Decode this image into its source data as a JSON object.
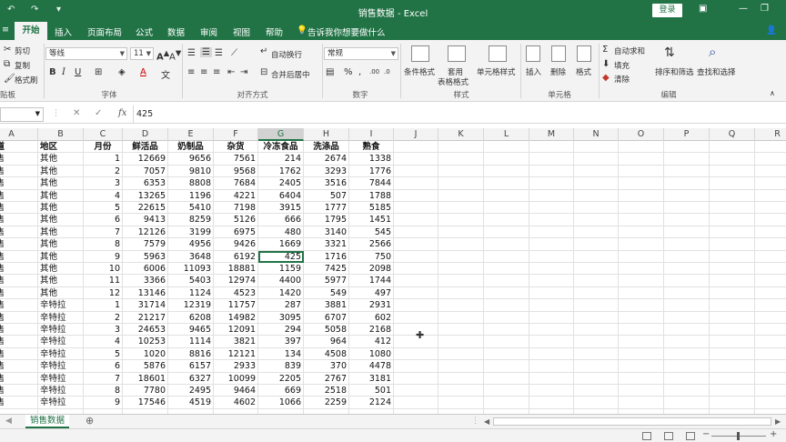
{
  "titlebar": {
    "title": "销售数据 - Excel",
    "login_label": "登录",
    "quick_access": [
      "↶",
      "↷",
      "▾"
    ]
  },
  "tabs": [
    "开始",
    "插入",
    "页面布局",
    "公式",
    "数据",
    "审阅",
    "视图",
    "帮助",
    "告诉我你想要做什么"
  ],
  "ribbon": {
    "clipboard": {
      "cut": "剪切",
      "copy": "复制",
      "format_painter": "格式刷",
      "label": "贴板"
    },
    "font": {
      "name": "等线",
      "size": "11",
      "label": "字体"
    },
    "alignment": {
      "wrap": "自动换行",
      "merge": "合并后居中",
      "label": "对齐方式"
    },
    "number": {
      "format": "常规",
      "label": "数字"
    },
    "styles": {
      "conditional": "条件格式",
      "table_format_1": "套用",
      "table_format_2": "表格格式",
      "cell_styles": "单元格样式",
      "label": "样式"
    },
    "cells": {
      "insert": "插入",
      "delete": "删除",
      "format": "格式",
      "label": "单元格"
    },
    "editing": {
      "autosum": "自动求和",
      "fill": "填充",
      "clear": "清除",
      "sort": "排序和筛选",
      "find": "查找和选择",
      "label": "编辑"
    }
  },
  "formula_bar": {
    "fx": "fx",
    "value": "425"
  },
  "columns": [
    "A",
    "B",
    "C",
    "D",
    "E",
    "F",
    "G",
    "H",
    "I",
    "J",
    "K",
    "L",
    "M",
    "N",
    "O",
    "P",
    "Q",
    "R"
  ],
  "selected_column": "G",
  "table_headers": [
    "渠道",
    "地区",
    "月份",
    "鲜活品",
    "奶制品",
    "杂货",
    "冷冻食品",
    "洗涤品",
    "熟食"
  ],
  "rows": [
    [
      "零售",
      "其他",
      "1",
      "12669",
      "9656",
      "7561",
      "214",
      "2674",
      "1338"
    ],
    [
      "零售",
      "其他",
      "2",
      "7057",
      "9810",
      "9568",
      "1762",
      "3293",
      "1776"
    ],
    [
      "零售",
      "其他",
      "3",
      "6353",
      "8808",
      "7684",
      "2405",
      "3516",
      "7844"
    ],
    [
      "零售",
      "其他",
      "4",
      "13265",
      "1196",
      "4221",
      "6404",
      "507",
      "1788"
    ],
    [
      "零售",
      "其他",
      "5",
      "22615",
      "5410",
      "7198",
      "3915",
      "1777",
      "5185"
    ],
    [
      "零售",
      "其他",
      "6",
      "9413",
      "8259",
      "5126",
      "666",
      "1795",
      "1451"
    ],
    [
      "零售",
      "其他",
      "7",
      "12126",
      "3199",
      "6975",
      "480",
      "3140",
      "545"
    ],
    [
      "零售",
      "其他",
      "8",
      "7579",
      "4956",
      "9426",
      "1669",
      "3321",
      "2566"
    ],
    [
      "零售",
      "其他",
      "9",
      "5963",
      "3648",
      "6192",
      "425",
      "1716",
      "750"
    ],
    [
      "零售",
      "其他",
      "10",
      "6006",
      "11093",
      "18881",
      "1159",
      "7425",
      "2098"
    ],
    [
      "零售",
      "其他",
      "11",
      "3366",
      "5403",
      "12974",
      "4400",
      "5977",
      "1744"
    ],
    [
      "零售",
      "其他",
      "12",
      "13146",
      "1124",
      "4523",
      "1420",
      "549",
      "497"
    ],
    [
      "零售",
      "辛特拉",
      "1",
      "31714",
      "12319",
      "11757",
      "287",
      "3881",
      "2931"
    ],
    [
      "零售",
      "辛特拉",
      "2",
      "21217",
      "6208",
      "14982",
      "3095",
      "6707",
      "602"
    ],
    [
      "零售",
      "辛特拉",
      "3",
      "24653",
      "9465",
      "12091",
      "294",
      "5058",
      "2168"
    ],
    [
      "零售",
      "辛特拉",
      "4",
      "10253",
      "1114",
      "3821",
      "397",
      "964",
      "412"
    ],
    [
      "零售",
      "辛特拉",
      "5",
      "1020",
      "8816",
      "12121",
      "134",
      "4508",
      "1080"
    ],
    [
      "零售",
      "辛特拉",
      "6",
      "5876",
      "6157",
      "2933",
      "839",
      "370",
      "4478"
    ],
    [
      "零售",
      "辛特拉",
      "7",
      "18601",
      "6327",
      "10099",
      "2205",
      "2767",
      "3181"
    ],
    [
      "零售",
      "辛特拉",
      "8",
      "7780",
      "2495",
      "9464",
      "669",
      "2518",
      "501"
    ],
    [
      "零售",
      "辛特拉",
      "9",
      "17546",
      "4519",
      "4602",
      "1066",
      "2259",
      "2124"
    ]
  ],
  "active_cell": {
    "row": 8,
    "col": 6
  },
  "sheet_tab": "销售数据",
  "colors": {
    "accent": "#217346",
    "ribbon_bg": "#f3f3f3"
  }
}
